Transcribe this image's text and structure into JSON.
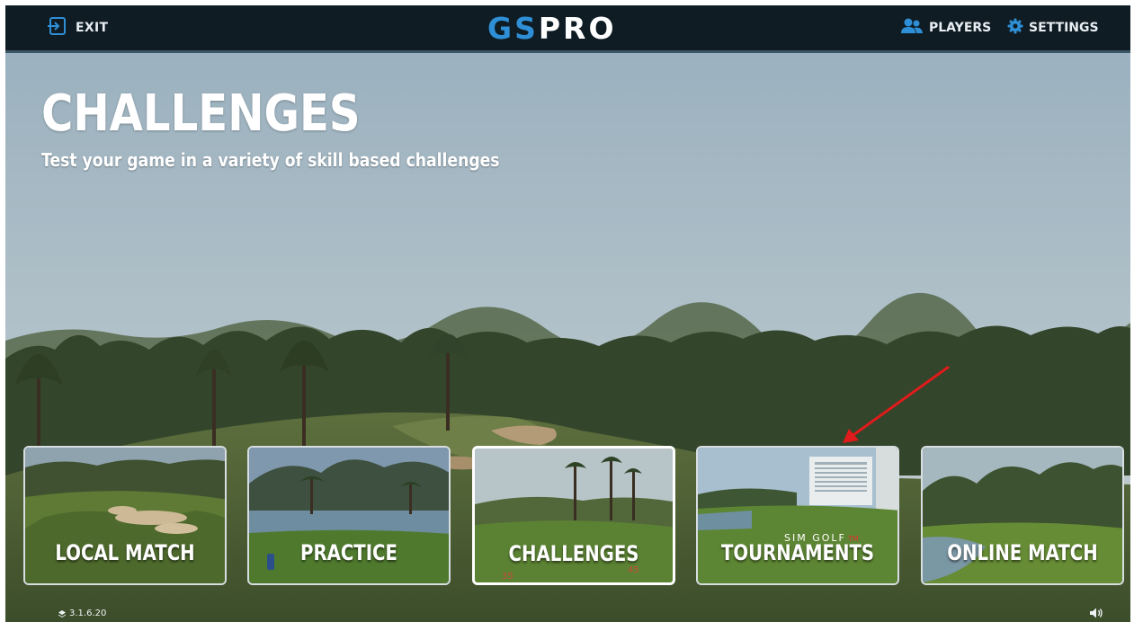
{
  "topbar": {
    "exit_label": "EXIT",
    "logo_part1": "GS",
    "logo_part2": "PRO",
    "players_label": "PLAYERS",
    "settings_label": "SETTINGS"
  },
  "header": {
    "title": "CHALLENGES",
    "subtitle": "Test your game in a variety of skill based challenges"
  },
  "modes": [
    {
      "label": "LOCAL MATCH",
      "selected": false
    },
    {
      "label": "PRACTICE",
      "selected": false
    },
    {
      "label": "CHALLENGES",
      "selected": true
    },
    {
      "label": "TOURNAMENTS",
      "selected": false,
      "brand": "SIM GOLF",
      "brand_suffix": "TM"
    },
    {
      "label": "ONLINE MATCH",
      "selected": false
    }
  ],
  "footer": {
    "version": "3.1.6.20",
    "volume_icon": "speaker-icon"
  },
  "colors": {
    "topbar_bg": "#0f1c24",
    "logo_accent": "#2f8fd6",
    "annotation_arrow": "#e01b1b"
  }
}
